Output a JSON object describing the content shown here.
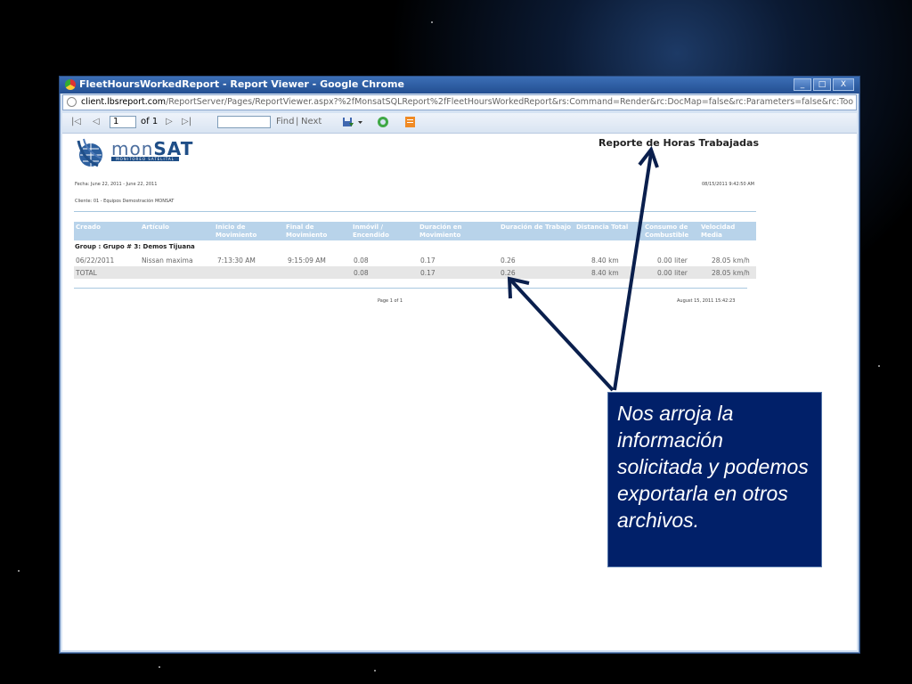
{
  "window": {
    "title": "FleetHoursWorkedReport - Report Viewer - Google Chrome",
    "min": "_",
    "max": "□",
    "close": "X"
  },
  "address": {
    "host": "client.lbsreport.com",
    "path": "/ReportServer/Pages/ReportViewer.aspx?%2fMonsatSQLReport%2fFleetHoursWorkedReport&rs:Command=Render&rc:DocMap=false&rc:Parameters=false&rc:Toolbar=true&ParameterXML=<Parameters><Re"
  },
  "toolbar": {
    "first": "|◁",
    "prev": "◁",
    "page_value": "1",
    "of_label": "of 1",
    "next": "▷",
    "last": "▷|",
    "find_label": "Find",
    "sep": "|",
    "next_label": "Next",
    "export": "▾"
  },
  "report": {
    "logo_left": "mon",
    "logo_right": "SAT",
    "logo_sub": "MONITOREO SATELITAL",
    "title": "Reporte de Horas Trabajadas",
    "fecha": "Fecha: June 22, 2011 - June 22, 2011",
    "timestamp": "08/15/2011 9:42:50 AM",
    "cliente": "Cliente: 01 - Equipos Demostración MONSAT",
    "columns": [
      "Creado",
      "Artículo",
      "Inicio de Movimiento",
      "Final de Movimiento",
      "Inmóvil / Encendido",
      "Duración en Movimiento",
      "Duración de Trabajo",
      "Distancia Total",
      "Consumo de Combustible",
      "Velocidad Media"
    ],
    "group": "Group : Grupo # 3: Demos Tijuana",
    "row": [
      "06/22/2011",
      "Nissan maxima",
      "7:13:30 AM",
      "9:15:09 AM",
      "0.08",
      "0.17",
      "0.26",
      "8.40 km",
      "0.00 liter",
      "28.05 km/h"
    ],
    "total": [
      "TOTAL",
      "0.08",
      "0.17",
      "0.26",
      "8.40 km",
      "0.00 liter",
      "28.05 km/h"
    ],
    "page": "Page 1 of 1",
    "footer_date": "August 15, 2011 15:42:23"
  },
  "callout": "Nos arroja la información solicitada y podemos exportarla en otros archivos.",
  "colors": {
    "callout_bg": "#012069",
    "header_bg": "#b8d3ea",
    "arrow": "#0a1f4d"
  }
}
